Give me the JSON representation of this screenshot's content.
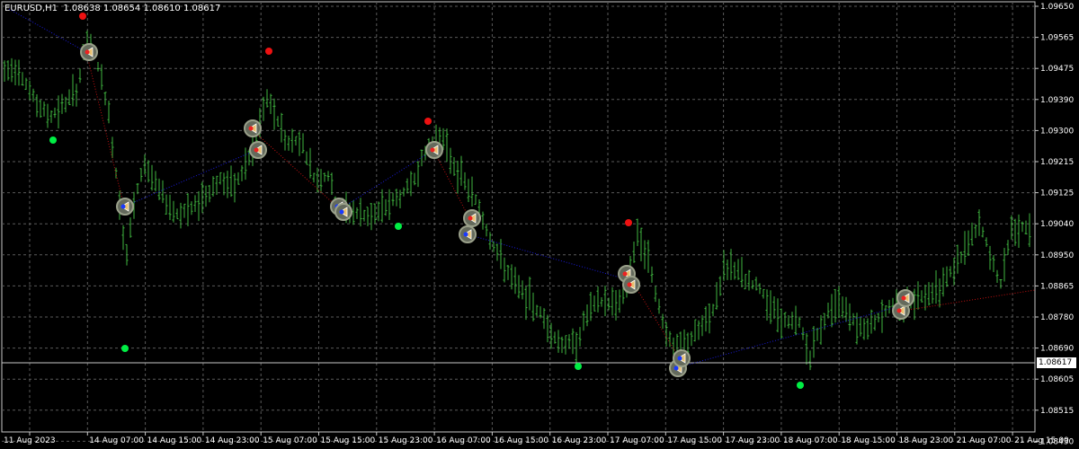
{
  "header": {
    "symbol": "EURUSD,H1",
    "quote": "1.08638 1.08654 1.08610 1.08617"
  },
  "price_axis": {
    "labels": [
      "1.09650",
      "1.09565",
      "1.09475",
      "1.09390",
      "1.09300",
      "1.09215",
      "1.09125",
      "1.09040",
      "1.08950",
      "1.08865",
      "1.08780",
      "1.08690",
      "1.08605",
      "1.08515",
      "1.08430"
    ],
    "current_price": "1.08617"
  },
  "time_axis": {
    "labels": [
      "11 Aug 2023",
      "14 Aug 07:00",
      "14 Aug 15:00",
      "14 Aug 23:00",
      "15 Aug 07:00",
      "15 Aug 15:00",
      "15 Aug 23:00",
      "16 Aug 07:00",
      "16 Aug 15:00",
      "16 Aug 23:00",
      "17 Aug 07:00",
      "17 Aug 15:00",
      "17 Aug 23:00",
      "18 Aug 07:00",
      "18 Aug 15:00",
      "18 Aug 23:00",
      "21 Aug 07:00",
      "21 Aug 15:00"
    ]
  },
  "colors": {
    "bars": "#3fb63f",
    "grid": "#5a5a5a",
    "up_dot": "#00ee44",
    "down_dot": "#ee1111",
    "zigzag_up": "#1a1ad9",
    "zigzag_down": "#c01010",
    "marker_ring": "#9aa08a"
  },
  "icons": [
    "buy-arrow-marker-icon",
    "sell-arrow-marker-icon",
    "signal-dot-icon"
  ]
}
